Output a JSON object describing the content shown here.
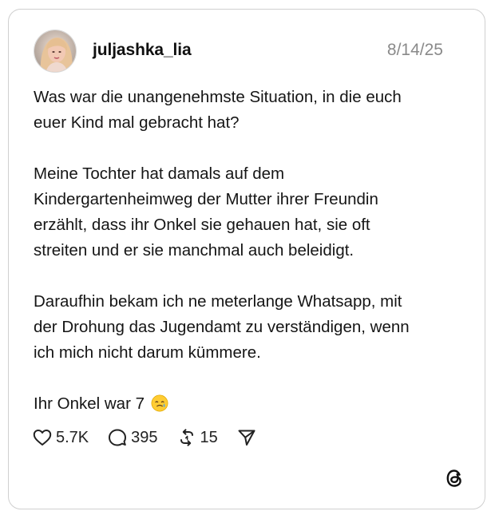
{
  "post": {
    "username": "juljashka_lia",
    "date": "8/14/25",
    "paragraphs": [
      "Was war die unangenehmste Situation, in die euch\neuer Kind mal gebracht hat?",
      "Meine Tochter hat damals auf dem\nKindergartenheimweg der Mutter ihrer Freundin\nerzählt, dass ihr Onkel sie gehauen hat, sie oft\nstreiten und er sie manchmal auch beleidigt.",
      "Daraufhin bekam ich ne meterlange Whatsapp, mit\nder Drohung das Jugendamt zu verständigen, wenn\nich mich nicht darum kümmere."
    ],
    "last_line": "Ihr Onkel war 7",
    "last_line_emoji": "face-holding-back-tears-icon"
  },
  "actions": {
    "likes": "5.7K",
    "comments": "395",
    "reposts": "15"
  },
  "icons": {
    "like": "heart-icon",
    "comment": "comment-bubble-icon",
    "repost": "repost-icon",
    "share": "send-icon",
    "brand": "threads-logo-icon"
  },
  "colors": {
    "text": "#151515",
    "muted": "#8a8a8a",
    "border": "#cfcfcf"
  }
}
